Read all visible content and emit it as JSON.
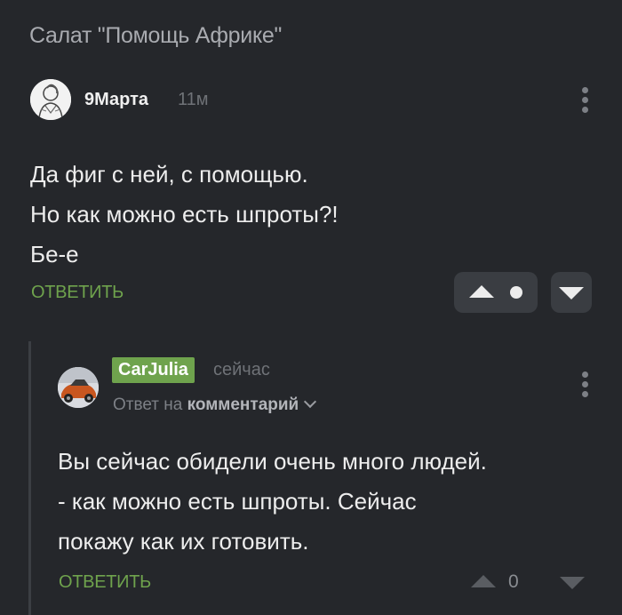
{
  "post": {
    "title": "Салат \"Помощь Африке\""
  },
  "comment": {
    "author": "9Марта",
    "time": "11м",
    "lines": [
      "Да фиг с ней, с помощью.",
      "Но как можно есть шпроты?!",
      "Бе-е"
    ],
    "reply_label": "ОТВЕТИТЬ"
  },
  "reply": {
    "author": "CarJulia",
    "time": "сейчас",
    "reply_to_prefix": "Ответ на",
    "reply_to_link": "комментарий",
    "lines": [
      "Вы сейчас обидели очень много людей.",
      "- как можно есть шпроты. Сейчас",
      "покажу как их готовить."
    ],
    "reply_label": "ОТВЕТИТЬ",
    "score": "0"
  },
  "colors": {
    "background": "#25272b",
    "accent_green": "#6fa34d",
    "muted": "#6f7277"
  },
  "icons": {
    "more": "kebab-icon",
    "upvote": "upvote-icon",
    "downvote": "downvote-icon",
    "expand": "chevron-down-icon"
  }
}
